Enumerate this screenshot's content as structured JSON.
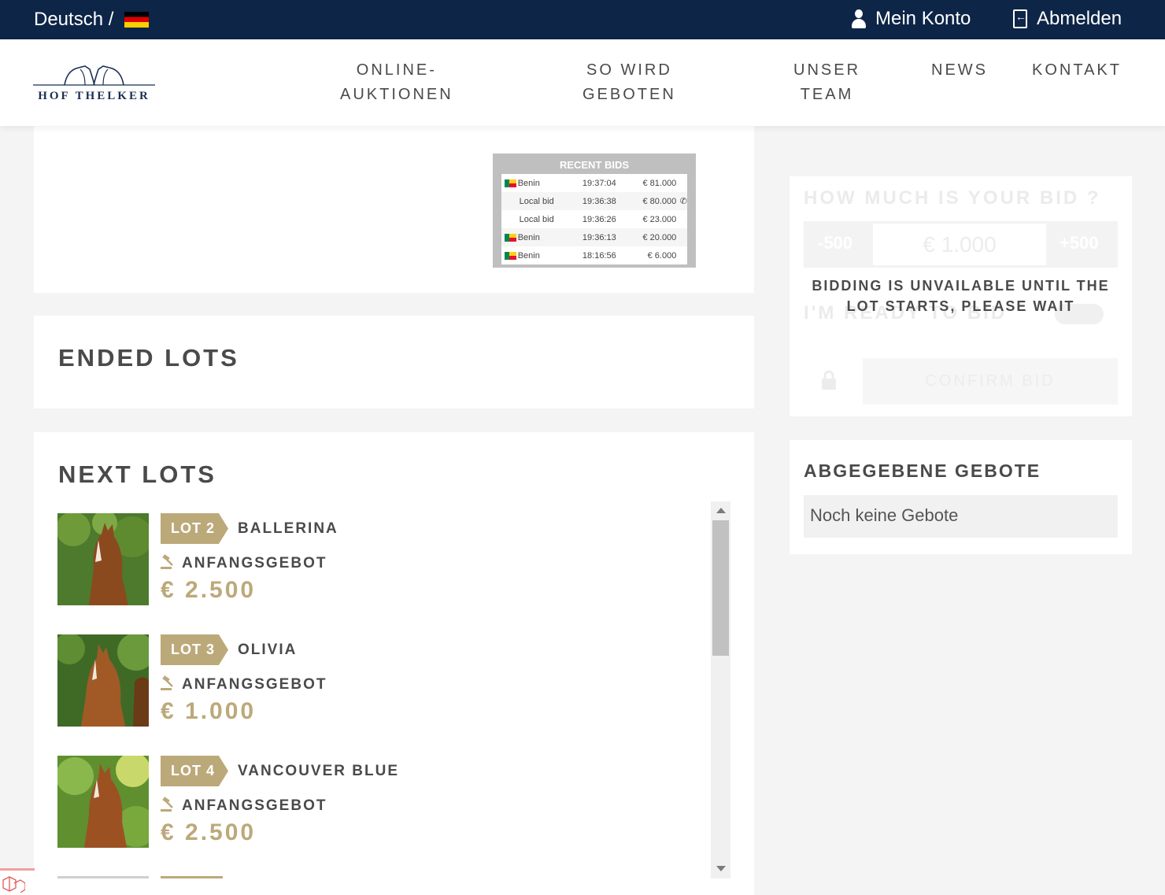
{
  "topbar": {
    "language": "Deutsch /",
    "account": "Mein Konto",
    "logout": "Abmelden"
  },
  "header": {
    "logo_text": "HOF THELKER",
    "nav": [
      {
        "line1": "ONLINE-",
        "line2": "AUKTIONEN"
      },
      {
        "line1": "SO WIRD",
        "line2": "GEBOTEN"
      },
      {
        "line1": "UNSER",
        "line2": "TEAM"
      },
      {
        "line1": "NEWS",
        "line2": ""
      },
      {
        "line1": "KONTAKT",
        "line2": ""
      }
    ]
  },
  "recent_bids": {
    "title": "RECENT BIDS",
    "rows": [
      {
        "country": "Benin",
        "time": "19:37:04",
        "amount": "€ 81.000",
        "flag": true,
        "phone": false
      },
      {
        "country": "Local bid",
        "time": "19:36:38",
        "amount": "€ 80.000",
        "flag": false,
        "phone": true
      },
      {
        "country": "Local bid",
        "time": "19:36:26",
        "amount": "€ 23.000",
        "flag": false,
        "phone": false
      },
      {
        "country": "Benin",
        "time": "19:36:13",
        "amount": "€ 20.000",
        "flag": true,
        "phone": false
      },
      {
        "country": "Benin",
        "time": "18:16:56",
        "amount": "€ 6.000",
        "flag": true,
        "phone": false
      }
    ]
  },
  "ended_lots": {
    "title": "ENDED LOTS"
  },
  "next_lots": {
    "title": "NEXT LOTS",
    "start_label": "ANFANGSGEBOT",
    "lots": [
      {
        "badge": "LOT 2",
        "name": "BALLERINA",
        "price": "€ 2.500"
      },
      {
        "badge": "LOT 3",
        "name": "OLIVIA",
        "price": "€ 1.000"
      },
      {
        "badge": "LOT 4",
        "name": "VANCOUVER BLUE",
        "price": "€ 2.500"
      }
    ]
  },
  "bid_panel": {
    "question": "HOW MUCH IS YOUR BID ?",
    "minus": "-500",
    "plus": "+500",
    "amount": "€ 1.000",
    "ready": "I'M READY TO BID",
    "unavailable_line1": "BIDDING IS UNVAILABLE UNTIL THE",
    "unavailable_line2": "LOT STARTS, PLEASE WAIT",
    "confirm": "CONFIRM BID"
  },
  "placed_bids": {
    "title": "ABGEGEBENE GEBOTE",
    "empty": "Noch keine Gebote"
  },
  "colors": {
    "topbar": "#0d2547",
    "gold": "#bca97a",
    "text": "#4a4a4a",
    "background": "#f4f4f4"
  }
}
